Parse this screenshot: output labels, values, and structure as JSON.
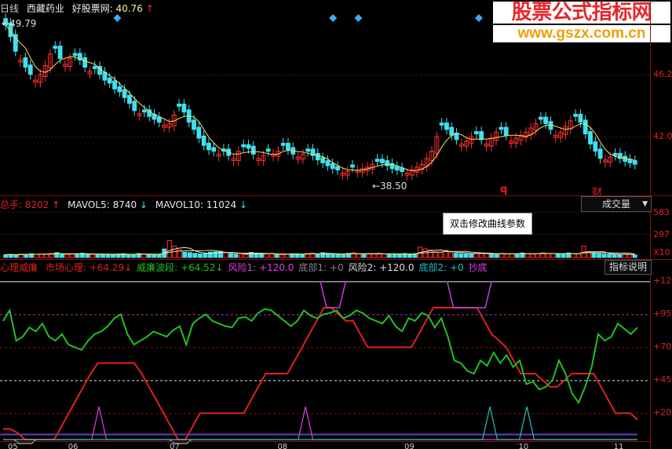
{
  "header": {
    "period": "日线",
    "stock_name": "西藏药业",
    "site_label": "好股票网:",
    "price": "40.76",
    "price_arrow": "↑"
  },
  "watermark": {
    "line1": "股票公式指标网",
    "line2": "www.gszx.com.cn"
  },
  "price_panel": {
    "high_label": "49.79",
    "low_label": "38.50",
    "y_ticks": [
      "46.2",
      "42.0"
    ],
    "markers": [
      "q",
      "财"
    ]
  },
  "volume_panel": {
    "total_label": "总手:",
    "total_value": "8202",
    "total_arrow": "↑",
    "mavol5_label": "MAVOL5:",
    "mavol5_value": "8740",
    "mavol5_arrow": "↓",
    "mavol10_label": "MAVOL10:",
    "mavol10_value": "11024",
    "mavol10_arrow": "↓",
    "dropdown_label": "成交量",
    "y_ticks": [
      "583",
      "297",
      "X10"
    ],
    "tooltip": "双击修改曲线参数"
  },
  "indicator_panel": {
    "name": "心理威廉",
    "items": [
      {
        "label": "市场心理:",
        "value": "+64.29",
        "arrow": "↓",
        "color": "#e02020"
      },
      {
        "label": "威廉波段:",
        "value": "+64.52",
        "arrow": "↓",
        "color": "#20c020"
      },
      {
        "label": "风险1:",
        "value": "+120.0",
        "arrow": "",
        "color": "#e040e0"
      },
      {
        "label": "底部1:",
        "value": "+0",
        "arrow": "",
        "color": "#888888"
      },
      {
        "label": "风险2:",
        "value": "+120.0",
        "arrow": "",
        "color": "#dddddd"
      },
      {
        "label": "底部2:",
        "value": "+0",
        "arrow": "",
        "color": "#20c0c0"
      },
      {
        "label": "抄底",
        "value": "",
        "arrow": "",
        "color": "#e040e0"
      }
    ],
    "help_button": "指标说明",
    "y_ticks": [
      "+120",
      "+95",
      "+70",
      "+45",
      "+20"
    ]
  },
  "x_axis": {
    "ticks": [
      "05",
      "06",
      "07",
      "08",
      "09",
      "10",
      "11"
    ]
  },
  "colors": {
    "up": "#ff3030",
    "down": "#40e0f0",
    "ma_line": "#e8e8e8",
    "psy_line": "#e02020",
    "williams_line": "#20c020",
    "risk_line": "#c040e0",
    "bottom_line": "#20c0c0",
    "base_line": "#6040c0"
  },
  "chart_data": [
    {
      "type": "candlestick",
      "title": "西藏药业 日线",
      "ylim": [
        37.5,
        50.5
      ],
      "y_ticks": [
        46.2,
        42.0
      ],
      "annotations": [
        {
          "text": "49.79",
          "kind": "high"
        },
        {
          "text": "38.50",
          "kind": "low"
        }
      ],
      "close": [
        49.2,
        48.4,
        47.4,
        46.8,
        46.3,
        45.8,
        45.4,
        45.8,
        46.4,
        47.2,
        47.6,
        46.9,
        46.5,
        46.9,
        47.1,
        46.8,
        46.3,
        46.0,
        46.2,
        45.8,
        45.4,
        45.2,
        44.8,
        44.6,
        44.2,
        43.8,
        43.3,
        43.1,
        43.2,
        42.9,
        42.7,
        42.5,
        42.3,
        42.4,
        43.0,
        43.6,
        43.2,
        42.5,
        42.0,
        41.4,
        40.9,
        40.6,
        40.5,
        40.3,
        40.5,
        40.2,
        40.0,
        40.5,
        40.8,
        40.7,
        40.3,
        40.0,
        40.2,
        40.5,
        40.3,
        40.5,
        40.9,
        40.6,
        40.3,
        40.1,
        40.3,
        40.5,
        40.2,
        39.9,
        39.7,
        39.5,
        39.3,
        39.2,
        39.0,
        39.1,
        39.4,
        39.2,
        39.3,
        39.4,
        39.6,
        39.8,
        39.7,
        39.5,
        39.3,
        39.2,
        39.1,
        39.0,
        39.2,
        39.4,
        39.6,
        40.0,
        40.5,
        41.5,
        42.3,
        42.0,
        41.6,
        41.3,
        41.0,
        41.2,
        41.5,
        41.7,
        41.3,
        41.0,
        41.4,
        41.8,
        42.0,
        41.6,
        41.2,
        41.4,
        41.6,
        41.8,
        42.1,
        42.4,
        42.7,
        42.4,
        42.0,
        41.6,
        41.8,
        42.2,
        42.6,
        42.9,
        42.5,
        41.7,
        41.0,
        40.5,
        40.0,
        39.9,
        40.1,
        40.2,
        40.0,
        39.8,
        39.7,
        39.6
      ],
      "up_flags": [
        0,
        0,
        0,
        1,
        0,
        0,
        1,
        1,
        1,
        1,
        0,
        0,
        1,
        1,
        0,
        0,
        0,
        1,
        0,
        0,
        0,
        0,
        0,
        0,
        0,
        0,
        0,
        1,
        0,
        0,
        0,
        0,
        1,
        1,
        1,
        0,
        0,
        0,
        0,
        0,
        0,
        0,
        0,
        1,
        0,
        0,
        1,
        1,
        0,
        0,
        0,
        1,
        1,
        0,
        1,
        1,
        0,
        0,
        0,
        1,
        1,
        0,
        0,
        0,
        0,
        0,
        0,
        0,
        1,
        1,
        0,
        1,
        1,
        1,
        1,
        0,
        0,
        0,
        0,
        0,
        0,
        1,
        1,
        1,
        1,
        1,
        1,
        1,
        0,
        0,
        0,
        0,
        1,
        1,
        1,
        0,
        0,
        1,
        1,
        1,
        0,
        0,
        1,
        1,
        1,
        1,
        1,
        1,
        0,
        0,
        0,
        1,
        1,
        1,
        1,
        0,
        0,
        0,
        0,
        0,
        0,
        1,
        1,
        0,
        0,
        0,
        0
      ]
    },
    {
      "type": "bar",
      "title": "成交量",
      "series": [
        {
          "name": "总手",
          "values": [
            30,
            32,
            28,
            36,
            34,
            40,
            33,
            35,
            38,
            44,
            52,
            36,
            30,
            34,
            40,
            46,
            38,
            30,
            28,
            33,
            35,
            30,
            36,
            40,
            32,
            30,
            42,
            38,
            34,
            30,
            28,
            90,
            180,
            120,
            80,
            56,
            52,
            44,
            38,
            40,
            56,
            60,
            66,
            48,
            40,
            36,
            34,
            30,
            54,
            42,
            34,
            38,
            44,
            30,
            28,
            34,
            40,
            38,
            30,
            44,
            48,
            36,
            50,
            42,
            32,
            30,
            28,
            44,
            52,
            40,
            34,
            36,
            40,
            46,
            38,
            32,
            30,
            34,
            42,
            36,
            40,
            110,
            92,
            80,
            60,
            54,
            76,
            50,
            44,
            40,
            38,
            36,
            48,
            44,
            40,
            36,
            34,
            44,
            40,
            38,
            36,
            48,
            40,
            38,
            42,
            50,
            44,
            40,
            36,
            34,
            48,
            40,
            38,
            120,
            60,
            44,
            40,
            36,
            34,
            30,
            32,
            36,
            30,
            26
          ]
        }
      ],
      "ylim": [
        0,
        600
      ],
      "y_ticks": [
        "583",
        "297",
        "X10"
      ]
    },
    {
      "type": "line",
      "title": "心理威廉",
      "ylim": [
        0,
        125
      ],
      "y_ticks": [
        120,
        95,
        70,
        45,
        20
      ],
      "series": [
        {
          "name": "市场心理",
          "values": [
            8,
            8,
            5,
            0,
            0,
            0,
            0,
            0,
            10,
            20,
            30,
            40,
            50,
            58,
            58,
            58,
            58,
            58,
            58,
            50,
            40,
            30,
            20,
            10,
            0,
            0,
            10,
            20,
            20,
            20,
            20,
            20,
            20,
            20,
            30,
            40,
            50,
            50,
            50,
            50,
            60,
            70,
            80,
            90,
            100,
            100,
            95,
            90,
            90,
            80,
            70,
            70,
            70,
            70,
            70,
            70,
            70,
            80,
            90,
            100,
            100,
            100,
            100,
            100,
            100,
            100,
            90,
            80,
            75,
            70,
            60,
            50,
            50,
            50,
            45,
            40,
            40,
            45,
            50,
            50,
            50,
            50,
            40,
            30,
            20,
            20,
            20,
            15
          ]
        },
        {
          "name": "威廉波段",
          "values": [
            90,
            98,
            75,
            78,
            85,
            82,
            88,
            78,
            75,
            80,
            72,
            70,
            68,
            75,
            80,
            82,
            86,
            92,
            95,
            80,
            72,
            75,
            78,
            82,
            80,
            78,
            83,
            86,
            72,
            88,
            92,
            95,
            90,
            88,
            86,
            85,
            92,
            93,
            90,
            96,
            99,
            98,
            94,
            90,
            86,
            90,
            98,
            94,
            92,
            95,
            96,
            98,
            92,
            94,
            98,
            96,
            92,
            90,
            88,
            94,
            86,
            82,
            92,
            90,
            96,
            94,
            85,
            92,
            78,
            60,
            58,
            52,
            50,
            60,
            56,
            66,
            58,
            64,
            55,
            60,
            42,
            44,
            38,
            40,
            45,
            60,
            50,
            35,
            28,
            40,
            55,
            80,
            75,
            78,
            88,
            84,
            80,
            85
          ]
        },
        {
          "name": "风险1",
          "values": [
            0,
            0,
            0,
            0,
            0,
            0,
            0,
            0,
            0,
            0,
            0,
            0,
            0,
            25,
            0,
            0,
            0,
            0,
            0,
            0,
            0,
            0,
            0,
            0,
            0,
            0,
            0,
            0,
            0,
            0,
            0,
            0,
            0,
            0,
            0,
            0,
            0,
            0,
            0,
            0,
            0,
            25,
            0,
            0,
            0,
            0,
            0,
            0,
            0,
            0,
            0,
            0,
            0,
            0,
            0,
            0,
            0,
            0,
            0,
            0,
            0,
            0,
            0,
            0,
            0,
            0,
            0,
            0,
            0,
            0,
            0,
            0,
            0,
            0,
            0,
            0,
            0,
            0,
            0,
            0,
            0,
            0,
            0,
            0,
            0,
            0,
            0
          ]
        },
        {
          "name": "风险2",
          "values": [
            120,
            120,
            120,
            120,
            120,
            120,
            120,
            120,
            120,
            120,
            120,
            120,
            120,
            120,
            120,
            120,
            120,
            120,
            120,
            120,
            120,
            120,
            120,
            120,
            120,
            120,
            120,
            120,
            120,
            120,
            120,
            120,
            120,
            120,
            120,
            120,
            120,
            120,
            120,
            120,
            120,
            120,
            120,
            120,
            120,
            120,
            120,
            120,
            120,
            120,
            120,
            120,
            120,
            120,
            120,
            120,
            120,
            120,
            120,
            120,
            120,
            120,
            120,
            120,
            120,
            120,
            120,
            120,
            120,
            120,
            120,
            120,
            120,
            120,
            120,
            120,
            120,
            120,
            120,
            120,
            120,
            120,
            120,
            120,
            120,
            120,
            120
          ]
        },
        {
          "name": "底部2",
          "values": [
            0,
            0,
            0,
            0,
            0,
            0,
            0,
            0,
            0,
            0,
            0,
            0,
            0,
            0,
            0,
            0,
            0,
            0,
            0,
            0,
            0,
            0,
            0,
            0,
            0,
            0,
            0,
            0,
            0,
            0,
            0,
            0,
            0,
            0,
            0,
            0,
            0,
            0,
            0,
            0,
            0,
            0,
            0,
            0,
            0,
            0,
            0,
            0,
            0,
            0,
            0,
            0,
            0,
            0,
            0,
            0,
            0,
            0,
            0,
            0,
            0,
            0,
            0,
            0,
            0,
            0,
            25,
            0,
            0,
            0,
            0,
            25,
            0,
            0,
            0,
            0,
            0,
            0,
            0,
            0,
            0,
            0,
            0,
            0,
            0,
            0,
            0
          ]
        }
      ]
    }
  ]
}
